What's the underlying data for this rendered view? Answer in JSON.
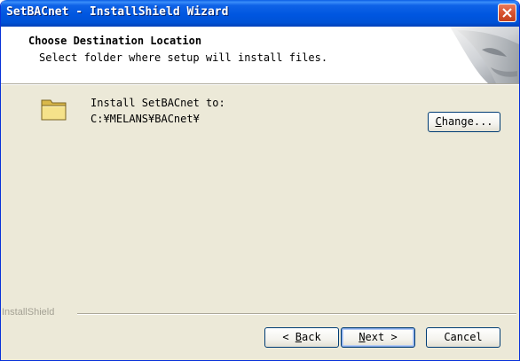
{
  "window": {
    "title": "SetBACnet - InstallShield Wizard",
    "accent_color": "#0054e3",
    "close_icon": "close-icon"
  },
  "header": {
    "title": "Choose Destination Location",
    "subtitle": "Select folder where setup will install files."
  },
  "destination": {
    "icon": "folder-icon",
    "label": "Install SetBACnet to:",
    "path": "C:¥MELANS¥BACnet¥"
  },
  "buttons": {
    "change": {
      "mnemonic": "C",
      "rest": "hange..."
    },
    "back": {
      "prefix": "< ",
      "mnemonic": "B",
      "rest": "ack"
    },
    "next": {
      "mnemonic": "N",
      "rest": "ext >"
    },
    "cancel": "Cancel"
  },
  "footer": {
    "brand": "InstallShield"
  }
}
